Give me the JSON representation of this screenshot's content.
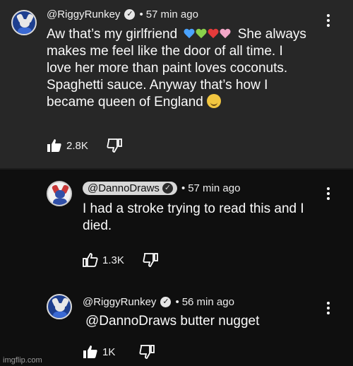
{
  "comments": [
    {
      "username": "@RiggyRunkey",
      "time": "57 min ago",
      "lines": [
        "Aw that’s my girlfriend",
        "She always",
        "makes me feel like the door of all time. I",
        "love her more than paint loves coconuts.",
        "Spaghetti sauce. Anyway that’s how I",
        "became queen of England"
      ],
      "likes": "2.8K",
      "heart_colors": [
        "#4aa3ff",
        "#8ad14b",
        "#e53b3b",
        "#f3a7c8"
      ]
    },
    {
      "username": "@DannoDraws",
      "time": "57 min ago",
      "lines": [
        "I had a stroke trying to read this and I",
        "died."
      ],
      "likes": "1.3K"
    },
    {
      "username": "@RiggyRunkey",
      "time": "56 min ago",
      "lines": [
        "@DannoDraws butter nugget"
      ],
      "likes": "1K"
    }
  ],
  "separator": "•",
  "watermark": "imgflip.com",
  "icons": {
    "verified": "verified-check-icon",
    "like": "thumbs-up-icon",
    "dislike": "thumbs-down-icon",
    "menu": "more-vertical-icon"
  }
}
